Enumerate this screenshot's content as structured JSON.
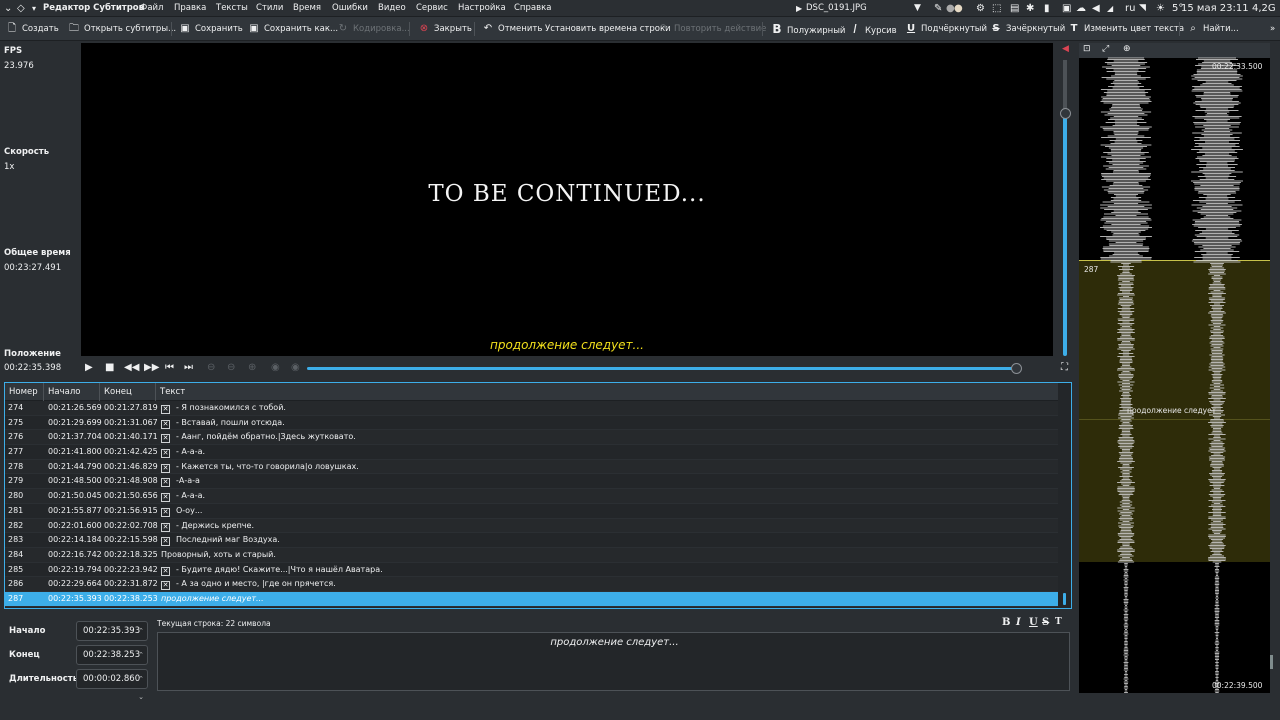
{
  "topbar": {
    "app_title": "Редактор Субтитров",
    "menu": [
      "Файл",
      "Правка",
      "Тексты",
      "Стили",
      "Время",
      "Ошибки",
      "Видео",
      "Сервис",
      "Настройка",
      "Справка"
    ],
    "media_name": "DSC_0191.JPG",
    "keyboard_layout": "ru",
    "temperature": "5°",
    "clock": "15 мая 23:11",
    "memory": "4,2G"
  },
  "toolbar": {
    "create": "Создать",
    "open": "Открыть субтитры...",
    "save": "Сохранить",
    "save_as": "Сохранить как...",
    "encoding": "Кодировка...",
    "close": "Закрыть",
    "undo": "Отменить Установить времена строки",
    "redo": "Повторить действие",
    "bold": "Полужирный",
    "italic": "Курсив",
    "underline": "Подчёркнутый",
    "strike": "Зачёркнутый",
    "color": "Изменить цвет текста",
    "find": "Найти..."
  },
  "info": {
    "fps_label": "FPS",
    "fps_value": "23.976",
    "speed_label": "Скорость",
    "speed_value": "1x",
    "total_label": "Общее время",
    "total_value": "00:23:27.491",
    "pos_label": "Положение",
    "pos_value": "00:22:35.398"
  },
  "video": {
    "frame_text": "TO BE CONTINUED...",
    "subtitle": "продолжение следует..."
  },
  "table": {
    "headers": [
      "Номер",
      "Начало",
      "Конец",
      "Текст"
    ],
    "rows": [
      {
        "n": "274",
        "start": "00:21:26.569",
        "end": "00:21:27.819",
        "text": "- Я познакомился с тобой.",
        "chk": true,
        "selected": false
      },
      {
        "n": "275",
        "start": "00:21:29.699",
        "end": "00:21:31.067",
        "text": "- Вставай, пошли отсюда.",
        "chk": true,
        "selected": false
      },
      {
        "n": "276",
        "start": "00:21:37.704",
        "end": "00:21:40.171",
        "text": "- Аанг, пойдём обратно.|Здесь жутковато.",
        "chk": true,
        "selected": false
      },
      {
        "n": "277",
        "start": "00:21:41.800",
        "end": "00:21:42.425",
        "text": "- А-а-а.",
        "chk": true,
        "selected": false
      },
      {
        "n": "278",
        "start": "00:21:44.790",
        "end": "00:21:46.829",
        "text": "- Кажется ты, что-то говорила|о ловушках.",
        "chk": true,
        "selected": false
      },
      {
        "n": "279",
        "start": "00:21:48.500",
        "end": "00:21:48.908",
        "text": "-А-а-а",
        "chk": true,
        "selected": false
      },
      {
        "n": "280",
        "start": "00:21:50.045",
        "end": "00:21:50.656",
        "text": "- А-а-а.",
        "chk": true,
        "selected": false
      },
      {
        "n": "281",
        "start": "00:21:55.877",
        "end": "00:21:56.915",
        "text": "О-оу...",
        "chk": true,
        "selected": false
      },
      {
        "n": "282",
        "start": "00:22:01.600",
        "end": "00:22:02.708",
        "text": "- Держись крепче.",
        "chk": true,
        "selected": false
      },
      {
        "n": "283",
        "start": "00:22:14.184",
        "end": "00:22:15.598",
        "text": "Последний маг Воздуха.",
        "chk": true,
        "selected": false
      },
      {
        "n": "284",
        "start": "00:22:16.742",
        "end": "00:22:18.325",
        "text": "Проворный, хоть и старый.",
        "chk": false,
        "selected": false
      },
      {
        "n": "285",
        "start": "00:22:19.794",
        "end": "00:22:23.942",
        "text": "- Будите дядю! Скажите...|Что я нашёл Аватара.",
        "chk": true,
        "selected": false
      },
      {
        "n": "286",
        "start": "00:22:29.664",
        "end": "00:22:31.872",
        "text": "- А за одно и место, |где он прячется.",
        "chk": true,
        "selected": false
      },
      {
        "n": "287",
        "start": "00:22:35.393",
        "end": "00:22:38.253",
        "text": "продолжение следует...",
        "chk": false,
        "selected": true
      }
    ]
  },
  "editor": {
    "start_label": "Начало",
    "start_value": "00:22:35.393",
    "end_label": "Конец",
    "end_value": "00:22:38.253",
    "dur_label": "Длительность",
    "dur_value": "00:00:02.860",
    "current_line": "Текущая строка: 22 символа",
    "text": "продолжение следует..."
  },
  "waveform": {
    "top_time": "00:22:33.500",
    "bottom_time": "00:22:39.500",
    "region_number": "287",
    "region_text": "продолжение следует"
  }
}
